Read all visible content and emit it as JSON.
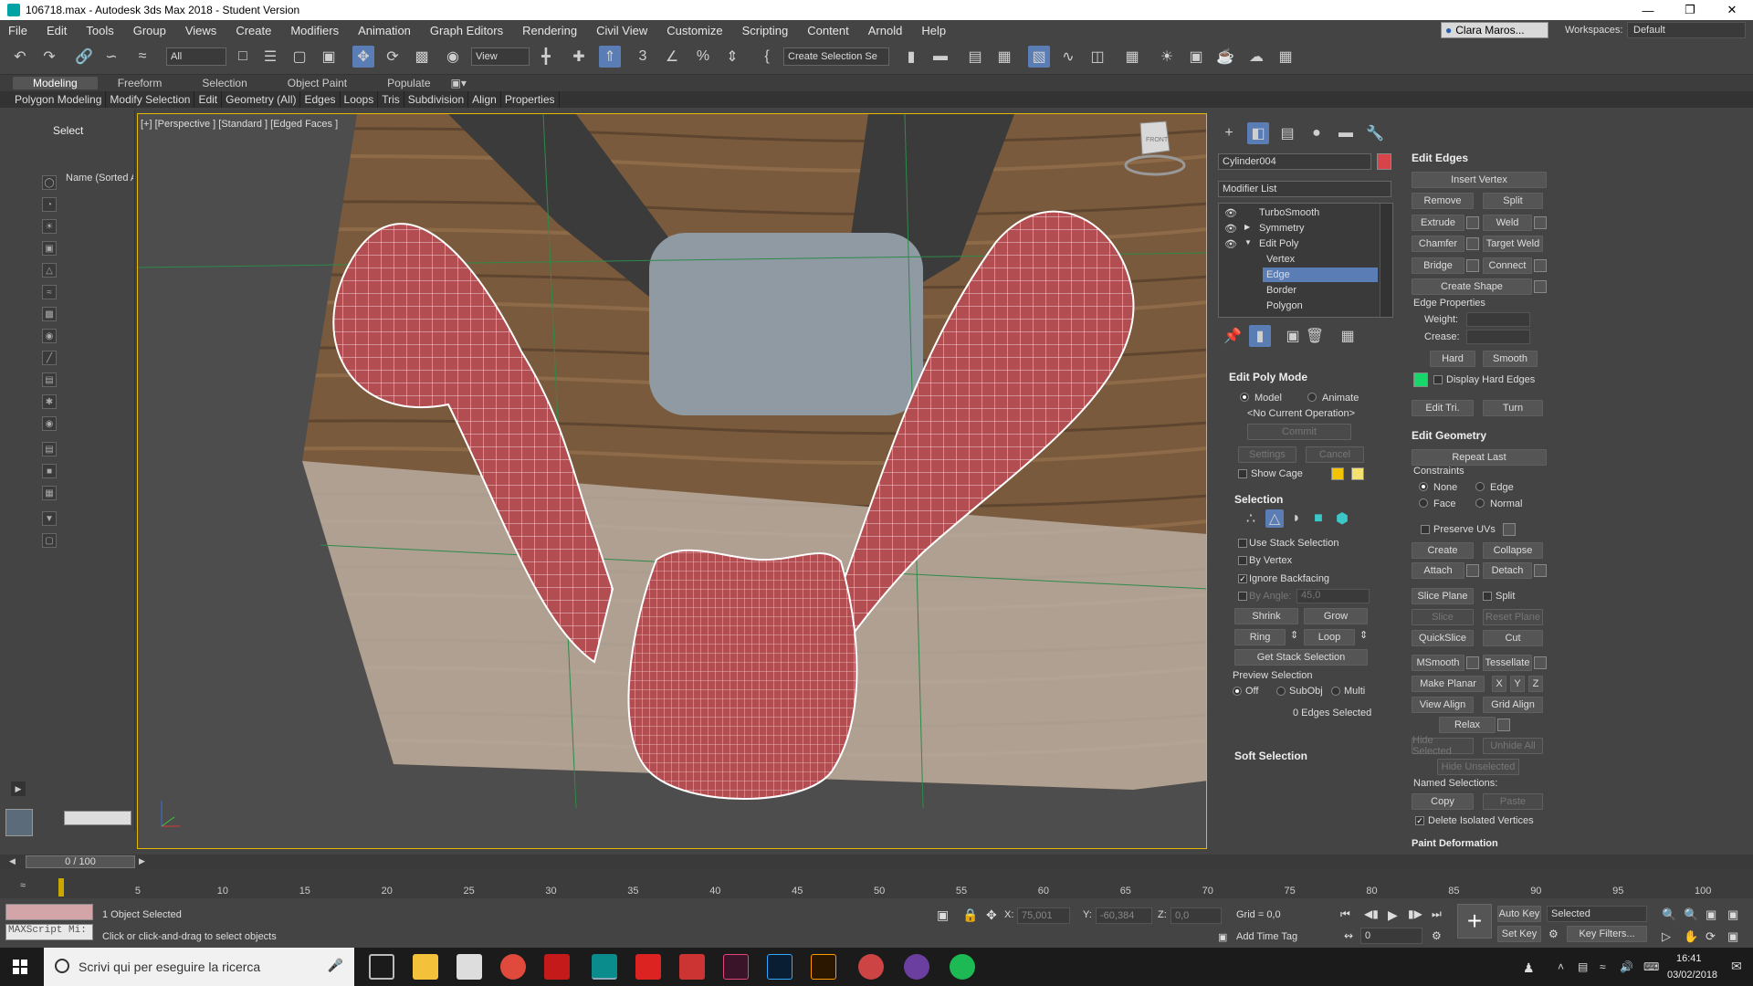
{
  "title": "106718.max - Autodesk 3ds Max 2018 - Student Version",
  "menu": [
    "File",
    "Edit",
    "Tools",
    "Group",
    "Views",
    "Create",
    "Modifiers",
    "Animation",
    "Graph Editors",
    "Rendering",
    "Civil View",
    "Customize",
    "Scripting",
    "Content",
    "Arnold",
    "Help"
  ],
  "user": "Clara Maros...",
  "workspaces_label": "Workspaces:",
  "workspace": "Default",
  "toolbar": {
    "filter": "All",
    "view": "View",
    "selection_set": "Create Selection Se"
  },
  "ribbon_tabs": [
    "Modeling",
    "Freeform",
    "Selection",
    "Object Paint",
    "Populate"
  ],
  "ribbon_items": [
    "Polygon Modeling",
    "Modify Selection",
    "Edit",
    "Geometry (All)",
    "Edges",
    "Loops",
    "Tris",
    "Subdivision",
    "Align",
    "Properties"
  ],
  "scene": {
    "select": "Select",
    "name_col": "Name (Sorted A"
  },
  "viewport_label": "[+] [Perspective ] [Standard ] [Edged Faces ]",
  "viewcube": "FRONT",
  "object_name": "Cylinder004",
  "modifier_list": "Modifier List",
  "stack": [
    "TurboSmooth",
    "Symmetry",
    "Edit Poly",
    "Vertex",
    "Edge",
    "Border",
    "Polygon"
  ],
  "edit_poly_mode": {
    "title": "Edit Poly Mode",
    "model": "Model",
    "animate": "Animate",
    "current": "<No Current Operation>",
    "commit": "Commit",
    "settings": "Settings",
    "cancel": "Cancel",
    "show_cage": "Show Cage"
  },
  "selection": {
    "title": "Selection",
    "use_stack": "Use Stack Selection",
    "by_vertex": "By Vertex",
    "ignore_backfacing": "Ignore Backfacing",
    "by_angle": "By Angle:",
    "angle": "45,0",
    "shrink": "Shrink",
    "grow": "Grow",
    "ring": "Ring",
    "loop": "Loop",
    "get_stack": "Get Stack Selection",
    "preview": "Preview Selection",
    "off": "Off",
    "subobj": "SubObj",
    "multi": "Multi",
    "status": "0 Edges Selected"
  },
  "soft_selection": "Soft Selection",
  "edit_edges": {
    "title": "Edit Edges",
    "insert_vertex": "Insert Vertex",
    "remove": "Remove",
    "split": "Split",
    "extrude": "Extrude",
    "weld": "Weld",
    "chamfer": "Chamfer",
    "target_weld": "Target Weld",
    "bridge": "Bridge",
    "connect": "Connect",
    "create_shape": "Create Shape",
    "edge_properties": "Edge Properties",
    "weight": "Weight:",
    "crease": "Crease:",
    "hard": "Hard",
    "smooth": "Smooth",
    "display_hard": "Display Hard Edges",
    "edit_tri": "Edit Tri.",
    "turn": "Turn"
  },
  "edit_geometry": {
    "title": "Edit Geometry",
    "repeat_last": "Repeat Last",
    "constraints": "Constraints",
    "none": "None",
    "edge": "Edge",
    "face": "Face",
    "normal": "Normal",
    "preserve_uvs": "Preserve UVs",
    "create": "Create",
    "collapse": "Collapse",
    "attach": "Attach",
    "detach": "Detach",
    "slice_plane": "Slice Plane",
    "split": "Split",
    "slice": "Slice",
    "reset_plane": "Reset Plane",
    "quickslice": "QuickSlice",
    "cut": "Cut",
    "msmooth": "MSmooth",
    "tessellate": "Tessellate",
    "make_planar": "Make Planar",
    "x": "X",
    "y": "Y",
    "z": "Z",
    "view_align": "View Align",
    "grid_align": "Grid Align",
    "relax": "Relax",
    "hide_selected": "Hide Selected",
    "unhide_all": "Unhide All",
    "hide_unselected": "Hide Unselected",
    "named_selections": "Named Selections:",
    "copy": "Copy",
    "paste": "Paste",
    "delete_isolated": "Delete Isolated Vertices"
  },
  "paint_deformation": "Paint Deformation",
  "timeline": {
    "frame": "0 / 100",
    "ticks": [
      "5",
      "10",
      "15",
      "20",
      "25",
      "30",
      "35",
      "40",
      "45",
      "50",
      "55",
      "60",
      "65",
      "70",
      "75",
      "80",
      "85",
      "90",
      "95",
      "100"
    ]
  },
  "status": {
    "maxscript": "MAXScript Mi:",
    "selected": "1 Object Selected",
    "hint": "Click or click-and-drag to select objects",
    "x": "75,001",
    "y": "-60,384",
    "z": "0,0",
    "grid": "Grid = 0,0",
    "add_time_tag": "Add Time Tag",
    "auto_key": "Auto Key",
    "set_key": "Set Key",
    "selected_dd": "Selected",
    "key_filters": "Key Filters...",
    "frame": "0"
  },
  "taskbar": {
    "search": "Scrivi qui per eseguire la ricerca",
    "time": "16:41",
    "date": "03/02/2018"
  },
  "colors": {
    "mesh": "#b24d51",
    "viewport_border": "#e6b800",
    "active_blue": "#5a7db5"
  }
}
